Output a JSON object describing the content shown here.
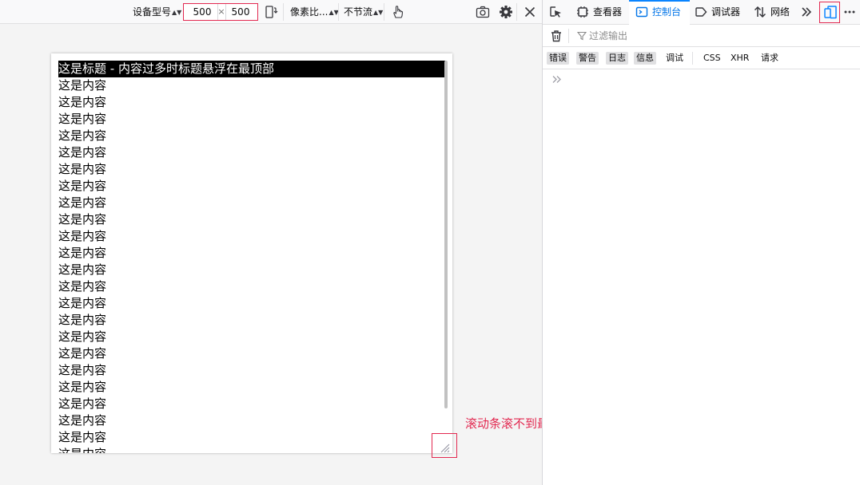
{
  "rdm_toolbar": {
    "device_label": "设备型号",
    "width": "500",
    "times": "×",
    "height": "500",
    "dpr_label": "像素比...",
    "throttle_label": "不节流"
  },
  "viewport": {
    "sticky_title": "这是标题 - 内容过多时标题悬浮在最顶部",
    "lines": [
      "这是内容",
      "这是内容",
      "这是内容",
      "这是内容",
      "这是内容",
      "这是内容",
      "这是内容",
      "这是内容",
      "这是内容",
      "这是内容",
      "这是内容",
      "这是内容",
      "这是内容",
      "这是内容",
      "这是内容",
      "这是内容",
      "这是内容",
      "这是内容",
      "这是内容",
      "这是内容",
      "这是内容",
      "这是内容",
      "这是内容"
    ]
  },
  "annotation": "滚动条滚不到最下面",
  "devtools": {
    "tabs": {
      "inspector": "查看器",
      "console": "控制台",
      "debugger": "调试器",
      "network": "网络"
    },
    "filter_placeholder": "过滤输出",
    "levels": [
      "错误",
      "警告",
      "日志",
      "信息",
      "调试",
      "CSS",
      "XHR",
      "请求"
    ]
  },
  "colors": {
    "accent": "#0a84ff",
    "annotation_red": "#e22850",
    "title_bg": "#000000"
  }
}
